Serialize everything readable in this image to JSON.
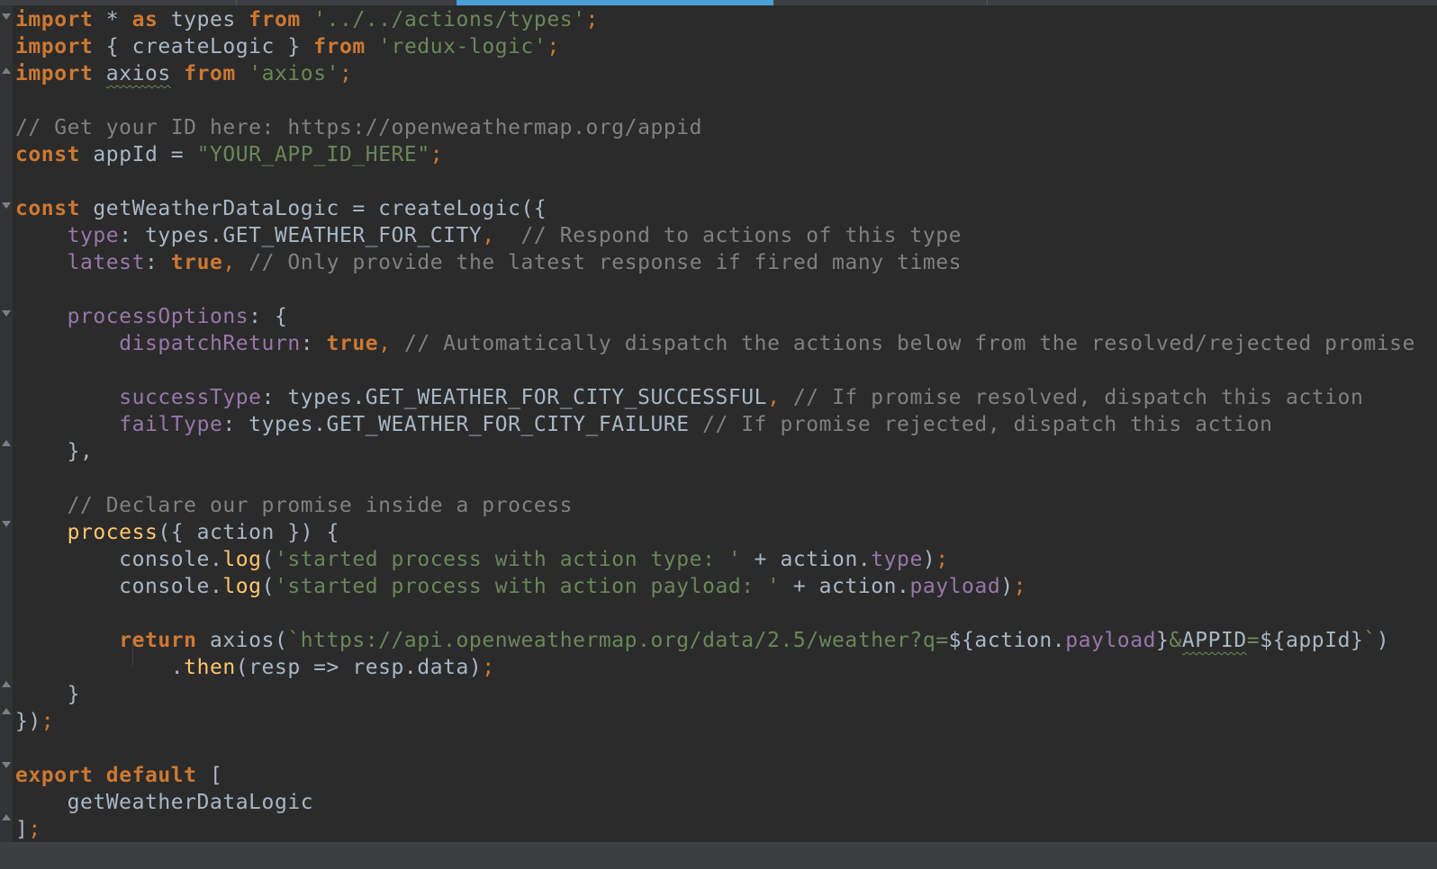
{
  "editor": {
    "file_language": "JavaScript",
    "code_lines": [
      [
        [
          "kw",
          "import"
        ],
        [
          "id",
          " * "
        ],
        [
          "kw",
          "as"
        ],
        [
          "id",
          " types "
        ],
        [
          "kw",
          "from"
        ],
        [
          "id",
          " "
        ],
        [
          "str",
          "'../../actions/types'"
        ],
        [
          "punc",
          ";"
        ]
      ],
      [
        [
          "kw",
          "import"
        ],
        [
          "id",
          " { createLogic } "
        ],
        [
          "kw",
          "from"
        ],
        [
          "id",
          " "
        ],
        [
          "str",
          "'redux-logic'"
        ],
        [
          "punc",
          ";"
        ]
      ],
      [
        [
          "kw",
          "import"
        ],
        [
          "id",
          " "
        ],
        [
          "warn",
          "axios"
        ],
        [
          "id",
          " "
        ],
        [
          "kw",
          "from"
        ],
        [
          "id",
          " "
        ],
        [
          "str",
          "'axios'"
        ],
        [
          "punc",
          ";"
        ]
      ],
      [],
      [
        [
          "cm",
          "// Get your ID here: https://openweathermap.org/appid"
        ]
      ],
      [
        [
          "kw",
          "const"
        ],
        [
          "id",
          " appId = "
        ],
        [
          "str",
          "\"YOUR_APP_ID_HERE\""
        ],
        [
          "punc",
          ";"
        ]
      ],
      [],
      [
        [
          "kw",
          "const"
        ],
        [
          "id",
          " getWeatherDataLogic = createLogic({"
        ]
      ],
      [
        [
          "id",
          "    "
        ],
        [
          "prop",
          "type"
        ],
        [
          "id",
          ": types.GET_WEATHER_FOR_CITY"
        ],
        [
          "punc",
          ","
        ],
        [
          "id",
          "  "
        ],
        [
          "cm",
          "// Respond to actions of this type"
        ]
      ],
      [
        [
          "id",
          "    "
        ],
        [
          "prop",
          "latest"
        ],
        [
          "id",
          ": "
        ],
        [
          "kw",
          "true"
        ],
        [
          "punc",
          ","
        ],
        [
          "id",
          " "
        ],
        [
          "cm",
          "// Only provide the latest response if fired many times"
        ]
      ],
      [],
      [
        [
          "id",
          "    "
        ],
        [
          "prop",
          "processOptions"
        ],
        [
          "id",
          ": {"
        ]
      ],
      [
        [
          "id",
          "        "
        ],
        [
          "prop",
          "dispatchReturn"
        ],
        [
          "id",
          ": "
        ],
        [
          "kw",
          "true"
        ],
        [
          "punc",
          ","
        ],
        [
          "id",
          " "
        ],
        [
          "cm",
          "// Automatically dispatch the actions below from the resolved/rejected promise"
        ]
      ],
      [],
      [
        [
          "id",
          "        "
        ],
        [
          "prop",
          "successType"
        ],
        [
          "id",
          ": types.GET_WEATHER_FOR_CITY_SUCCESSFUL"
        ],
        [
          "punc",
          ","
        ],
        [
          "id",
          " "
        ],
        [
          "cm",
          "// If promise resolved, dispatch this action"
        ]
      ],
      [
        [
          "id",
          "        "
        ],
        [
          "prop",
          "failType"
        ],
        [
          "id",
          ": types.GET_WEATHER_FOR_CITY_FAILURE "
        ],
        [
          "cm",
          "// If promise rejected, dispatch this action"
        ]
      ],
      [
        [
          "id",
          "    },"
        ]
      ],
      [],
      [
        [
          "id",
          "    "
        ],
        [
          "cm",
          "// Declare our promise inside a process"
        ]
      ],
      [
        [
          "id",
          "    "
        ],
        [
          "fn",
          "process"
        ],
        [
          "id",
          "({ action }) {"
        ]
      ],
      [
        [
          "id",
          "        console."
        ],
        [
          "fn",
          "log"
        ],
        [
          "id",
          "("
        ],
        [
          "str",
          "'started process with action type: '"
        ],
        [
          "id",
          " + action."
        ],
        [
          "prop",
          "type"
        ],
        [
          "id",
          ")"
        ],
        [
          "punc",
          ";"
        ]
      ],
      [
        [
          "id",
          "        console."
        ],
        [
          "fn",
          "log"
        ],
        [
          "id",
          "("
        ],
        [
          "str",
          "'started process with action payload: '"
        ],
        [
          "id",
          " + action."
        ],
        [
          "prop",
          "payload"
        ],
        [
          "id",
          ")"
        ],
        [
          "punc",
          ";"
        ]
      ],
      [],
      [
        [
          "id",
          "        "
        ],
        [
          "kw",
          "return"
        ],
        [
          "id",
          " axios("
        ],
        [
          "tpl",
          "`https://api.openweathermap.org/data/2.5/weather?q="
        ],
        [
          "id",
          "${action."
        ],
        [
          "prop",
          "payload"
        ],
        [
          "id",
          "}"
        ],
        [
          "tpl",
          "&"
        ],
        [
          "warn",
          "APPID"
        ],
        [
          "tpl",
          "="
        ],
        [
          "id",
          "${appId}"
        ],
        [
          "tpl",
          "`"
        ],
        [
          "id",
          ")"
        ]
      ],
      [
        [
          "id",
          "            ."
        ],
        [
          "fn",
          "then"
        ],
        [
          "id",
          "(resp => resp.data)"
        ],
        [
          "punc",
          ";"
        ]
      ],
      [
        [
          "id",
          "    }"
        ]
      ],
      [
        [
          "id",
          "})"
        ],
        [
          "punc",
          ";"
        ]
      ],
      [],
      [
        [
          "kw",
          "export"
        ],
        [
          "id",
          " "
        ],
        [
          "kw",
          "default"
        ],
        [
          "id",
          " ["
        ]
      ],
      [
        [
          "id",
          "    getWeatherDataLogic"
        ]
      ],
      [
        [
          "id",
          "]"
        ],
        [
          "punc",
          ";"
        ]
      ]
    ]
  }
}
